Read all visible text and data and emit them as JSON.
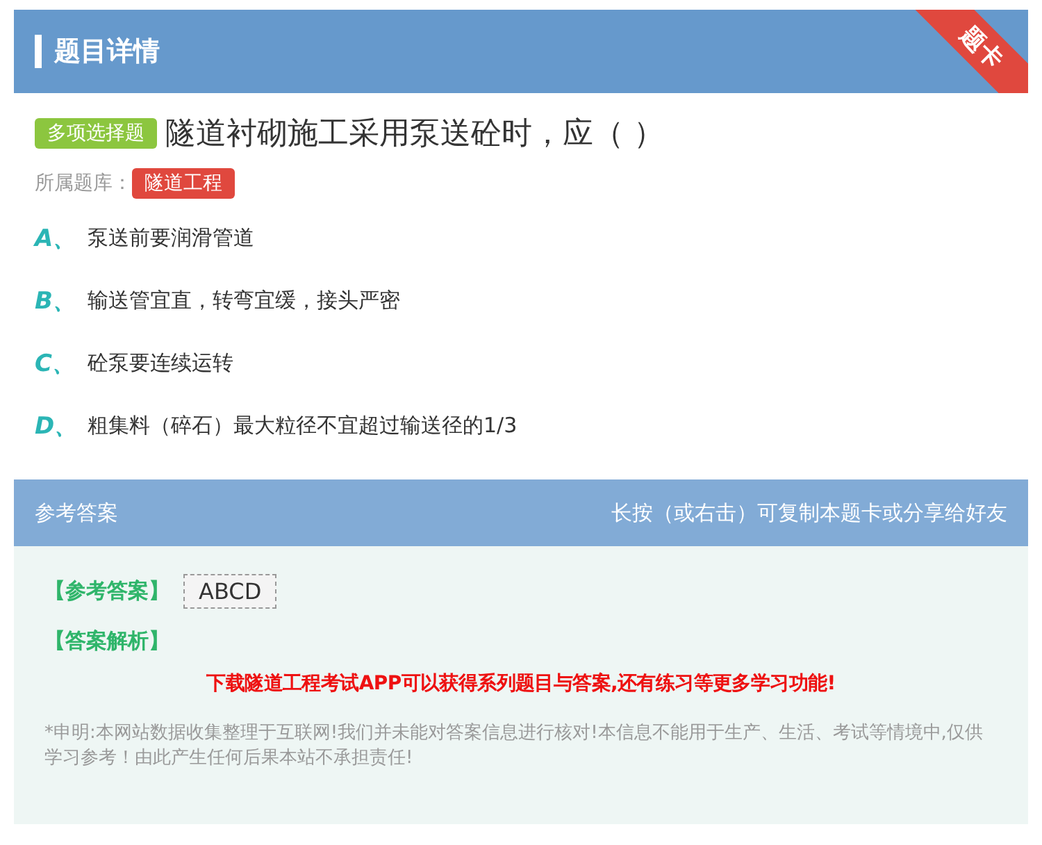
{
  "header": {
    "title": "题目详情",
    "ribbon": "题卡"
  },
  "question": {
    "type_tag": "多项选择题",
    "text": "隧道衬砌施工采用泵送砼时，应（ ）",
    "bank_label": "所属题库：",
    "bank_tag": "隧道工程"
  },
  "options": [
    {
      "letter": "A、",
      "text": "泵送前要润滑管道"
    },
    {
      "letter": "B、",
      "text": "输送管宜直，转弯宜缓，接头严密"
    },
    {
      "letter": "C、",
      "text": "砼泵要连续运转"
    },
    {
      "letter": "D、",
      "text": "粗集料（碎石）最大粒径不宜超过输送径的1/3"
    }
  ],
  "answer_section": {
    "title": "参考答案",
    "hint": "长按（或右击）可复制本题卡或分享给好友",
    "answer_label": "【参考答案】",
    "answer_value": "ABCD",
    "analysis_label": "【答案解析】",
    "promo": "下载隧道工程考试APP可以获得系列题目与答案,还有练习等更多学习功能!",
    "disclaimer": "*申明:本网站数据收集整理于互联网!我们并未能对答案信息进行核对!本信息不能用于生产、生活、考试等情境中,仅供学习参考！由此产生任何后果本站不承担责任!"
  }
}
